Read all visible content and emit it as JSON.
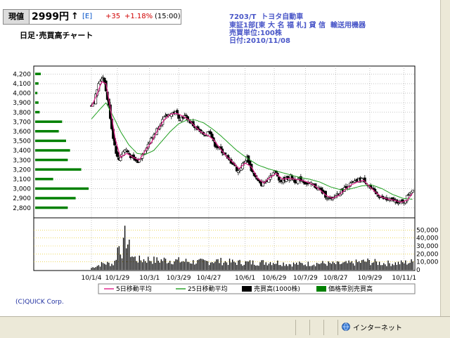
{
  "header": {
    "label": "現値",
    "price": "2999円",
    "arrow": "↑",
    "market": "[E]",
    "change": "+35",
    "change_pct": "+1.18%",
    "time": "(15:00)"
  },
  "chart_title": "日足･売買高チャート",
  "info": {
    "line1": "7203/T  トヨタ自動車",
    "line2": "東証1部[東 大 名 福 札] 貸 信  輸送用機器",
    "line3": "売買単位:100株",
    "line4": "日付:2010/11/08"
  },
  "copyright": "(C)QUICK Corp.",
  "status": {
    "text": "インターネット"
  },
  "colors": {
    "ma5": "#e0208a",
    "ma25": "#20a020",
    "volume": "#000000",
    "profile": "#008000",
    "grid": "#a0a0a0",
    "vol_grid": "#e0c000"
  },
  "chart_data": {
    "type": "candlestick",
    "price_axis": {
      "ylim": [
        2740,
        4240
      ],
      "ticks": [
        2800,
        2900,
        3000,
        3100,
        3200,
        3300,
        3400,
        3500,
        3600,
        3700,
        3800,
        3900,
        4000,
        4100,
        4200
      ],
      "tick_labels": [
        "2,800",
        "2,900",
        "3,000",
        "3,100",
        "3,200",
        "3,300",
        "3,400",
        "3,500",
        "3,600",
        "3,700",
        "3,800",
        "3,900",
        "4,000",
        "4,100",
        "4,200"
      ]
    },
    "volume_axis": {
      "ylim": [
        0,
        60000
      ],
      "ticks": [
        0,
        10000,
        20000,
        30000,
        40000,
        50000
      ],
      "tick_labels": [
        "0",
        "10,000",
        "20,000",
        "30,000",
        "40,000",
        "50,000"
      ]
    },
    "x_axis": {
      "labels": [
        "10/1/4",
        "10/1/29",
        "10/3/1",
        "10/3/29",
        "10/4/27",
        "10/6/1",
        "10/6/29",
        "10/7/29",
        "10/8/27",
        "10/9/29",
        "10/11/1"
      ],
      "label_days": [
        0,
        25,
        56,
        84,
        113,
        148,
        176,
        206,
        235,
        268,
        301
      ],
      "day_range": [
        0,
        310
      ]
    },
    "close_anchors": [
      [
        0,
        3880
      ],
      [
        3,
        3920
      ],
      [
        6,
        4060
      ],
      [
        9,
        4150
      ],
      [
        12,
        4180
      ],
      [
        14,
        4020
      ],
      [
        17,
        3850
      ],
      [
        20,
        3600
      ],
      [
        23,
        3420
      ],
      [
        26,
        3290
      ],
      [
        29,
        3360
      ],
      [
        33,
        3420
      ],
      [
        37,
        3350
      ],
      [
        41,
        3300
      ],
      [
        45,
        3280
      ],
      [
        49,
        3360
      ],
      [
        53,
        3440
      ],
      [
        57,
        3510
      ],
      [
        62,
        3600
      ],
      [
        67,
        3700
      ],
      [
        72,
        3760
      ],
      [
        77,
        3790
      ],
      [
        81,
        3800
      ],
      [
        85,
        3740
      ],
      [
        90,
        3760
      ],
      [
        95,
        3700
      ],
      [
        100,
        3640
      ],
      [
        105,
        3590
      ],
      [
        110,
        3560
      ],
      [
        114,
        3620
      ],
      [
        118,
        3470
      ],
      [
        123,
        3420
      ],
      [
        127,
        3380
      ],
      [
        132,
        3300
      ],
      [
        137,
        3260
      ],
      [
        141,
        3180
      ],
      [
        146,
        3260
      ],
      [
        150,
        3330
      ],
      [
        154,
        3200
      ],
      [
        159,
        3100
      ],
      [
        163,
        3040
      ],
      [
        168,
        3080
      ],
      [
        173,
        3150
      ],
      [
        177,
        3180
      ],
      [
        182,
        3080
      ],
      [
        187,
        3100
      ],
      [
        192,
        3130
      ],
      [
        196,
        3080
      ],
      [
        201,
        3100
      ],
      [
        206,
        3060
      ],
      [
        211,
        3050
      ],
      [
        216,
        3020
      ],
      [
        221,
        2980
      ],
      [
        226,
        2920
      ],
      [
        231,
        2880
      ],
      [
        236,
        2940
      ],
      [
        241,
        2980
      ],
      [
        246,
        3020
      ],
      [
        251,
        3060
      ],
      [
        256,
        3080
      ],
      [
        261,
        3110
      ],
      [
        265,
        3060
      ],
      [
        270,
        2990
      ],
      [
        275,
        2940
      ],
      [
        280,
        2900
      ],
      [
        285,
        2880
      ],
      [
        290,
        2880
      ],
      [
        294,
        2870
      ],
      [
        297,
        2860
      ],
      [
        300,
        2850
      ],
      [
        303,
        2900
      ],
      [
        306,
        2960
      ],
      [
        309,
        2990
      ]
    ],
    "ma5_anchors": [
      [
        0,
        3860
      ],
      [
        5,
        3980
      ],
      [
        10,
        4120
      ],
      [
        14,
        4100
      ],
      [
        18,
        3860
      ],
      [
        23,
        3520
      ],
      [
        28,
        3330
      ],
      [
        34,
        3370
      ],
      [
        40,
        3330
      ],
      [
        46,
        3300
      ],
      [
        52,
        3400
      ],
      [
        58,
        3490
      ],
      [
        64,
        3620
      ],
      [
        70,
        3720
      ],
      [
        76,
        3780
      ],
      [
        82,
        3790
      ],
      [
        88,
        3760
      ],
      [
        94,
        3720
      ],
      [
        100,
        3650
      ],
      [
        106,
        3590
      ],
      [
        112,
        3560
      ],
      [
        118,
        3510
      ],
      [
        124,
        3420
      ],
      [
        130,
        3340
      ],
      [
        136,
        3280
      ],
      [
        142,
        3210
      ],
      [
        148,
        3270
      ],
      [
        154,
        3230
      ],
      [
        160,
        3110
      ],
      [
        166,
        3060
      ],
      [
        172,
        3120
      ],
      [
        178,
        3160
      ],
      [
        184,
        3100
      ],
      [
        190,
        3110
      ],
      [
        196,
        3100
      ],
      [
        202,
        3090
      ],
      [
        208,
        3070
      ],
      [
        214,
        3040
      ],
      [
        220,
        2990
      ],
      [
        226,
        2930
      ],
      [
        232,
        2900
      ],
      [
        238,
        2930
      ],
      [
        244,
        2990
      ],
      [
        250,
        3040
      ],
      [
        256,
        3070
      ],
      [
        262,
        3090
      ],
      [
        268,
        3020
      ],
      [
        274,
        2960
      ],
      [
        280,
        2910
      ],
      [
        286,
        2890
      ],
      [
        292,
        2880
      ],
      [
        298,
        2860
      ],
      [
        304,
        2880
      ],
      [
        309,
        2950
      ]
    ],
    "ma25_anchors": [
      [
        0,
        3730
      ],
      [
        8,
        3830
      ],
      [
        14,
        3900
      ],
      [
        20,
        3780
      ],
      [
        28,
        3600
      ],
      [
        36,
        3460
      ],
      [
        44,
        3370
      ],
      [
        52,
        3360
      ],
      [
        60,
        3400
      ],
      [
        68,
        3500
      ],
      [
        76,
        3600
      ],
      [
        84,
        3680
      ],
      [
        92,
        3720
      ],
      [
        100,
        3720
      ],
      [
        108,
        3690
      ],
      [
        116,
        3630
      ],
      [
        124,
        3560
      ],
      [
        132,
        3480
      ],
      [
        140,
        3400
      ],
      [
        150,
        3320
      ],
      [
        160,
        3250
      ],
      [
        170,
        3210
      ],
      [
        180,
        3180
      ],
      [
        190,
        3150
      ],
      [
        200,
        3120
      ],
      [
        210,
        3100
      ],
      [
        220,
        3070
      ],
      [
        230,
        3020
      ],
      [
        240,
        2990
      ],
      [
        250,
        3000
      ],
      [
        260,
        3030
      ],
      [
        270,
        3040
      ],
      [
        280,
        3000
      ],
      [
        290,
        2940
      ],
      [
        300,
        2900
      ],
      [
        309,
        2890
      ]
    ],
    "volume_anchors": [
      [
        0,
        3000
      ],
      [
        12,
        10000
      ],
      [
        22,
        9000
      ],
      [
        26,
        38000
      ],
      [
        30,
        28000
      ],
      [
        33,
        54000
      ],
      [
        36,
        34000
      ],
      [
        40,
        19000
      ],
      [
        46,
        15000
      ],
      [
        55,
        16000
      ],
      [
        62,
        14000
      ],
      [
        70,
        15000
      ],
      [
        80,
        14000
      ],
      [
        90,
        13000
      ],
      [
        100,
        12000
      ],
      [
        110,
        12000
      ],
      [
        118,
        14000
      ],
      [
        130,
        12000
      ],
      [
        145,
        11000
      ],
      [
        160,
        11000
      ],
      [
        175,
        12000
      ],
      [
        190,
        9000
      ],
      [
        205,
        9000
      ],
      [
        220,
        10000
      ],
      [
        235,
        9000
      ],
      [
        250,
        10000
      ],
      [
        265,
        13000
      ],
      [
        280,
        10000
      ],
      [
        295,
        10000
      ],
      [
        309,
        12000
      ]
    ],
    "price_volume_profile": {
      "bins": [
        4200,
        4150,
        4100,
        4050,
        4000,
        3950,
        3900,
        3850,
        3800,
        3750,
        3700,
        3650,
        3600,
        3550,
        3500,
        3450,
        3400,
        3350,
        3300,
        3250,
        3200,
        3150,
        3100,
        3050,
        3000,
        2950,
        2900,
        2850,
        2800
      ],
      "relative_volume": [
        0.1,
        0.0,
        0.06,
        0.0,
        0.04,
        0.0,
        0.06,
        0.0,
        0.08,
        0.0,
        0.48,
        0.0,
        0.42,
        0.0,
        0.55,
        0.0,
        0.62,
        0.0,
        0.58,
        0.0,
        0.82,
        0.0,
        0.32,
        0.0,
        0.95,
        0.0,
        0.72,
        0.0,
        0.58
      ]
    },
    "legend": [
      {
        "label": "5日移動平均",
        "kind": "line",
        "color": "#e0208a"
      },
      {
        "label": "25日移動平均",
        "kind": "line",
        "color": "#20a020"
      },
      {
        "label": "売買高(1000株)",
        "kind": "bar",
        "color": "#000000"
      },
      {
        "label": "価格帯別売買高",
        "kind": "bar",
        "color": "#008000"
      }
    ]
  }
}
